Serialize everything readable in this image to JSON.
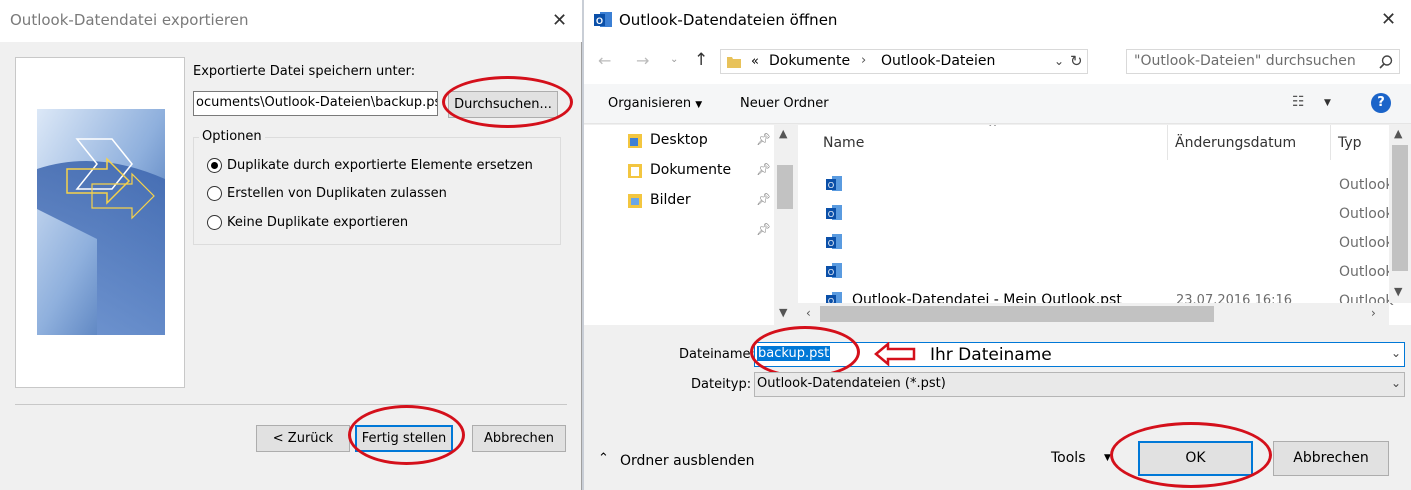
{
  "left_dialog": {
    "title": "Outlook-Datendatei exportieren",
    "save_label": "Exportierte Datei speichern unter:",
    "path_value": "ocuments\\Outlook-Dateien\\backup.pst",
    "browse_button": "Durchsuchen...",
    "options_label": "Optionen",
    "options": [
      {
        "label": "Duplikate durch exportierte Elemente ersetzen",
        "selected": true
      },
      {
        "label": "Erstellen von Duplikaten zulassen",
        "selected": false
      },
      {
        "label": "Keine Duplikate exportieren",
        "selected": false
      }
    ],
    "back_button": "< Zurück",
    "finish_button": "Fertig stellen",
    "cancel_button": "Abbrechen"
  },
  "right_dialog": {
    "title": "Outlook-Datendateien öffnen",
    "breadcrumb_sep": "«",
    "breadcrumb": [
      "Dokumente",
      "Outlook-Dateien"
    ],
    "search_placeholder": "\"Outlook-Dateien\" durchsuchen",
    "organize_label": "Organisieren",
    "new_folder_label": "Neuer Ordner",
    "sidebar_items": [
      {
        "label": "Desktop"
      },
      {
        "label": "Dokumente"
      },
      {
        "label": "Bilder"
      }
    ],
    "columns": {
      "name": "Name",
      "date": "Änderungsdatum",
      "type": "Typ"
    },
    "files": [
      {
        "name": "",
        "date": "",
        "type": "Outlook"
      },
      {
        "name": "",
        "date": "",
        "type": "Outlook"
      },
      {
        "name": "",
        "date": "",
        "type": "Outlook"
      },
      {
        "name": "",
        "date": "",
        "type": "Outlook"
      },
      {
        "name": "Outlook-Datendatei - Mein Outlook.pst",
        "date": "23.07.2016 16:16",
        "type": "Outlook"
      }
    ],
    "filename_label": "Dateiname:",
    "filename_value": "backup.pst",
    "annotation": "Ihr Dateiname",
    "filetype_label": "Dateityp:",
    "filetype_value": "Outlook-Datendateien (*.pst)",
    "hide_folders_label": "Ordner ausblenden",
    "tools_label": "Tools",
    "ok_button": "OK",
    "cancel_button": "Abbrechen"
  },
  "colors": {
    "accent": "#0078d7",
    "highlight_ellipse": "#d4101b",
    "selection": "#0078d7"
  }
}
